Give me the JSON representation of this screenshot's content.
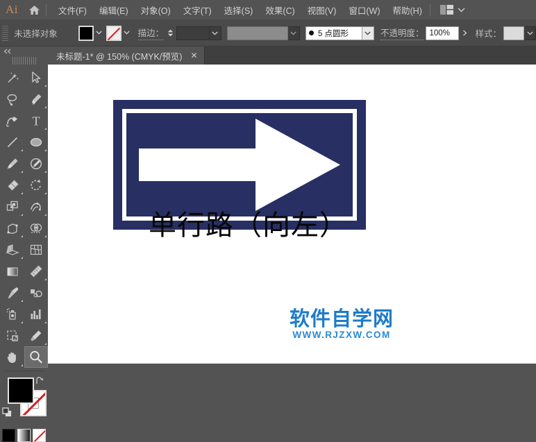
{
  "app": {
    "name": "Adobe Illustrator",
    "logo_text": "Ai",
    "logo_color": "#cd8a5c"
  },
  "menubar": {
    "home_icon": "home-icon",
    "items": [
      {
        "label": "文件(F)"
      },
      {
        "label": "编辑(E)"
      },
      {
        "label": "对象(O)"
      },
      {
        "label": "文字(T)"
      },
      {
        "label": "选择(S)"
      },
      {
        "label": "效果(C)"
      },
      {
        "label": "视图(V)"
      },
      {
        "label": "窗口(W)"
      },
      {
        "label": "帮助(H)"
      }
    ],
    "arrange_icon": "arrange-documents-icon",
    "arrange_caret": "⌄"
  },
  "controlbar": {
    "selection_status": "未选择对象",
    "fill_swatch": {
      "name": "fill-color",
      "color": "#000000"
    },
    "stroke_swatch": {
      "name": "stroke-color",
      "color": "none"
    },
    "stroke_label": "描边：",
    "stroke_weight_value": "",
    "variable_width_value": "",
    "brush_label": "5 点圆形",
    "opacity_label": "不透明度：",
    "opacity_value": "100%",
    "style_label": "样式：",
    "caret": "⌄"
  },
  "tabbar": {
    "tabs": [
      {
        "title": "未标题-1* @ 150% (CMYK/预览)",
        "close": "✕",
        "active": true
      }
    ]
  },
  "toolbar": {
    "collapse_icon": "double-chevron-left-icon",
    "grip": "drag-grip",
    "tools": [
      {
        "name": "magic-wand-tool",
        "has_submenu": false
      },
      {
        "name": "direct-selection-tool",
        "has_submenu": true
      },
      {
        "name": "lasso-tool",
        "has_submenu": false
      },
      {
        "name": "pen-tool",
        "has_submenu": true
      },
      {
        "name": "curvature-tool",
        "has_submenu": false
      },
      {
        "name": "type-tool",
        "has_submenu": true
      },
      {
        "name": "line-segment-tool",
        "has_submenu": true
      },
      {
        "name": "ellipse-tool",
        "has_submenu": true
      },
      {
        "name": "paintbrush-tool",
        "has_submenu": true
      },
      {
        "name": "shaper-tool",
        "has_submenu": true
      },
      {
        "name": "eraser-tool",
        "has_submenu": true
      },
      {
        "name": "rotate-tool",
        "has_submenu": true
      },
      {
        "name": "scale-tool",
        "has_submenu": true
      },
      {
        "name": "width-warp-tool",
        "has_submenu": true
      },
      {
        "name": "free-transform-tool",
        "has_submenu": false
      },
      {
        "name": "shape-builder-tool",
        "has_submenu": true
      },
      {
        "name": "perspective-grid-tool",
        "has_submenu": true
      },
      {
        "name": "mesh-tool",
        "has_submenu": false
      },
      {
        "name": "gradient-tool",
        "has_submenu": false
      },
      {
        "name": "measure-tool",
        "has_submenu": true
      },
      {
        "name": "eyedropper-tool",
        "has_submenu": true
      },
      {
        "name": "blend-tool",
        "has_submenu": false
      },
      {
        "name": "symbol-sprayer-tool",
        "has_submenu": true
      },
      {
        "name": "column-graph-tool",
        "has_submenu": true
      },
      {
        "name": "artboard-tool",
        "has_submenu": false
      },
      {
        "name": "slice-tool",
        "has_submenu": true
      },
      {
        "name": "hand-tool",
        "has_submenu": true
      },
      {
        "name": "zoom-tool",
        "has_submenu": false,
        "active": true
      }
    ],
    "fill_color": "#000000",
    "stroke_color": "none",
    "swap_icon": "swap-fill-stroke-icon",
    "default_icon": "default-fill-stroke-icon",
    "color_modes": [
      {
        "name": "color-mode-button",
        "kind": "solid"
      },
      {
        "name": "gradient-mode-button",
        "kind": "gradient"
      },
      {
        "name": "none-mode-button",
        "kind": "none"
      }
    ]
  },
  "canvas": {
    "background": "#ffffff",
    "artwork": {
      "name": "one-way-road-sign",
      "sign_color": "#272f63",
      "border_color": "#ffffff",
      "arrow_color": "#ffffff",
      "arrow_direction": "right"
    },
    "caption": "单行路（向左）",
    "watermark": {
      "cn": "软件自学网",
      "url": "WWW.RJZXW.COM",
      "color": "#1e7cc8"
    }
  }
}
